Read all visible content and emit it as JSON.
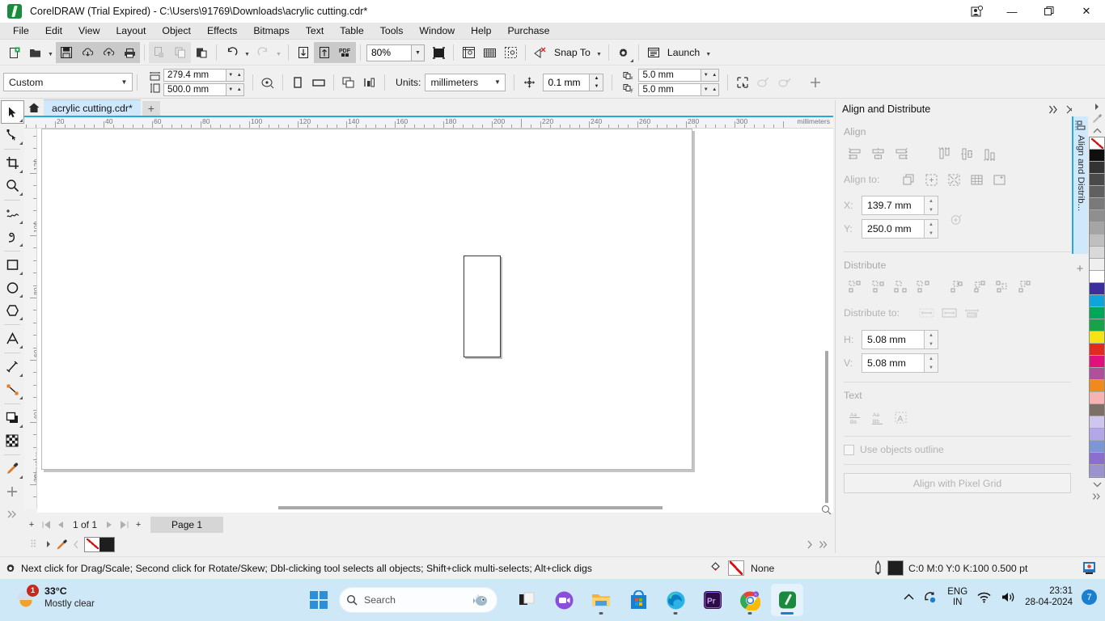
{
  "window": {
    "title": "CorelDRAW (Trial Expired) - C:\\Users\\91769\\Downloads\\acrylic cutting.cdr*",
    "minimize_label": "—",
    "maximize_label": "❐",
    "close_label": "✕",
    "account_icon": "account-icon"
  },
  "menu": {
    "items": [
      {
        "label": "File"
      },
      {
        "label": "Edit"
      },
      {
        "label": "View"
      },
      {
        "label": "Layout"
      },
      {
        "label": "Object"
      },
      {
        "label": "Effects"
      },
      {
        "label": "Bitmaps"
      },
      {
        "label": "Text"
      },
      {
        "label": "Table"
      },
      {
        "label": "Tools"
      },
      {
        "label": "Window"
      },
      {
        "label": "Help"
      },
      {
        "label": "Purchase"
      }
    ]
  },
  "standard_toolbar": {
    "buttons": [
      {
        "name": "new-document",
        "icon": "new-doc-icon"
      },
      {
        "name": "open-document",
        "icon": "open-folder-icon"
      },
      {
        "name": "save-document",
        "icon": "save-icon"
      },
      {
        "name": "download-from-cloud",
        "icon": "cloud-download-icon"
      },
      {
        "name": "upload-to-cloud",
        "icon": "cloud-upload-icon"
      },
      {
        "name": "print",
        "icon": "printer-icon"
      },
      {
        "name": "cut",
        "icon": "cut-icon"
      },
      {
        "name": "copy",
        "icon": "copy-icon"
      },
      {
        "name": "paste",
        "icon": "paste-icon"
      },
      {
        "name": "undo",
        "icon": "undo-icon"
      },
      {
        "name": "redo",
        "icon": "redo-icon"
      },
      {
        "name": "import",
        "icon": "import-icon"
      },
      {
        "name": "export",
        "icon": "export-icon"
      },
      {
        "name": "export-pdf",
        "icon": "pdf-icon"
      }
    ],
    "zoom_level": "80%",
    "fullscreen_preview": "fullscreen-preview-icon",
    "view_rulers": "rulers-icon",
    "view_grid": "grid-icon",
    "view_guides": "guides-icon",
    "snap_off": "snap-off-icon",
    "snap_to_label": "Snap To",
    "options_label": "options-gear-icon",
    "launch_label": "Launch"
  },
  "property_bar": {
    "page_preset": "Custom",
    "page_width": "279.4 mm",
    "page_height": "500.0 mm",
    "orientation_portrait": "portrait-icon",
    "orientation_landscape": "landscape-icon",
    "all_pages_icon": "all-pages-icon",
    "current_page_icon": "current-page-icon",
    "auto_fit_icon": "auto-fit-page-icon",
    "units_label": "Units:",
    "units_value": "millimeters",
    "nudge_icon": "nudge-icon",
    "nudge_value": "0.1 mm",
    "duplicate_x_label": "X",
    "duplicate_x": "5.0 mm",
    "duplicate_y_label": "Y",
    "duplicate_y": "5.0 mm",
    "bounding_box_icon": "bounding-box-icon",
    "edit_shape_icon": "edit-shape-icon",
    "accept_shape_icon": "accept-shape-icon",
    "add_icon": "plus-icon"
  },
  "document_tabs": {
    "home_icon": "home-icon",
    "active_tab": "acrylic cutting.cdr*",
    "add_tab": "+"
  },
  "toolbox": {
    "tools": [
      {
        "name": "pick-tool",
        "icon": "arrow-cursor-icon",
        "active": true
      },
      {
        "name": "shape-tool",
        "icon": "node-edit-icon",
        "active": false
      },
      {
        "name": "crop-tool",
        "icon": "crop-icon",
        "active": false
      },
      {
        "name": "zoom-tool",
        "icon": "magnifier-icon",
        "active": false
      },
      {
        "name": "freehand-tool",
        "icon": "freehand-pen-icon",
        "active": false
      },
      {
        "name": "artistic-media-tool",
        "icon": "artistic-media-icon",
        "active": false
      },
      {
        "name": "rectangle-tool",
        "icon": "rectangle-icon",
        "active": false
      },
      {
        "name": "ellipse-tool",
        "icon": "ellipse-icon",
        "active": false
      },
      {
        "name": "polygon-tool",
        "icon": "polygon-icon",
        "active": false
      },
      {
        "name": "text-tool",
        "icon": "text-a-icon",
        "active": false
      },
      {
        "name": "parallel-dimension-tool",
        "icon": "dimension-line-icon",
        "active": false
      },
      {
        "name": "connector-tool",
        "icon": "connector-icon",
        "active": false
      },
      {
        "name": "drop-shadow-tool",
        "icon": "drop-shadow-icon",
        "active": false
      },
      {
        "name": "transparency-tool",
        "icon": "transparency-checker-icon",
        "active": false
      },
      {
        "name": "color-eyedropper-tool",
        "icon": "eyedropper-icon",
        "active": false
      },
      {
        "name": "interactive-fill-tool",
        "icon": "plus-fill-icon",
        "active": false
      },
      {
        "name": "more-tools",
        "icon": "chevron-double-right-icon",
        "active": false
      }
    ]
  },
  "rulers": {
    "unit_label": "millimeters",
    "horizontal_ticks": [
      20,
      40,
      60,
      80,
      100,
      120,
      140,
      160,
      180,
      200,
      220,
      240,
      260,
      280,
      300
    ],
    "vertical_ticks": [
      20,
      40,
      60,
      80,
      100,
      120
    ]
  },
  "canvas": {
    "shape_name": "rectangle-object"
  },
  "page_nav": {
    "add_page_before": "+",
    "first_page": "⏮",
    "prev_page": "◀",
    "page_counter": "1 of 1",
    "next_page": "▶",
    "last_page": "⏭",
    "add_page_after": "+",
    "page_tab": "Page 1"
  },
  "color_status_strip": {
    "expand_icon": "expand-arrow-icon",
    "eyedropper_icon": "eyedropper-icon",
    "back_icon": "nav-back-icon",
    "fill_swatch": "none",
    "outline_swatch": "#1e1e1e"
  },
  "docker": {
    "title": "Align and Distribute",
    "collapse_icon": "collapse-right-icon",
    "close_icon": "close-icon",
    "align_section": "Align",
    "align_buttons": [
      {
        "name": "align-left",
        "icon": "align-left-icon"
      },
      {
        "name": "align-center-horizontally",
        "icon": "align-center-h-icon"
      },
      {
        "name": "align-right",
        "icon": "align-right-icon"
      },
      {
        "name": "align-top",
        "icon": "align-top-icon"
      },
      {
        "name": "align-center-vertically",
        "icon": "align-center-v-icon"
      },
      {
        "name": "align-bottom",
        "icon": "align-bottom-icon"
      }
    ],
    "align_to_label": "Align to:",
    "align_to_buttons": [
      {
        "name": "align-to-active-objects",
        "icon": "active-objects-icon"
      },
      {
        "name": "align-to-page-edge",
        "icon": "page-edge-icon"
      },
      {
        "name": "align-to-page-center",
        "icon": "page-center-icon"
      },
      {
        "name": "align-to-grid",
        "icon": "grid-icon"
      },
      {
        "name": "align-to-specified-point",
        "icon": "specified-point-icon"
      }
    ],
    "x_label": "X:",
    "x_value": "139.7 mm",
    "y_label": "Y:",
    "y_value": "250.0 mm",
    "pick_point_icon": "pick-point-icon",
    "distribute_section": "Distribute",
    "distribute_buttons": [
      {
        "name": "distribute-left",
        "icon": "distribute-left-icon"
      },
      {
        "name": "distribute-center-horizontally",
        "icon": "distribute-center-h-icon"
      },
      {
        "name": "distribute-space-horizontally",
        "icon": "distribute-space-h-icon"
      },
      {
        "name": "distribute-right",
        "icon": "distribute-right-icon"
      },
      {
        "name": "distribute-top",
        "icon": "distribute-top-icon"
      },
      {
        "name": "distribute-center-vertically",
        "icon": "distribute-center-v-icon"
      },
      {
        "name": "distribute-space-vertically",
        "icon": "distribute-space-v-icon"
      },
      {
        "name": "distribute-bottom",
        "icon": "distribute-bottom-icon"
      }
    ],
    "distribute_to_label": "Distribute to:",
    "distribute_to_buttons": [
      {
        "name": "distribute-to-selection-extent",
        "icon": "selection-extent-icon"
      },
      {
        "name": "distribute-to-page-extent",
        "icon": "page-extent-icon"
      },
      {
        "name": "distribute-to-spacing",
        "icon": "spacing-icon"
      }
    ],
    "h_label": "H:",
    "h_value": "5.08 mm",
    "v_label": "V:",
    "v_value": "5.08 mm",
    "text_section": "Text",
    "text_buttons": [
      {
        "name": "text-first-line-baseline",
        "icon": "first-line-baseline-icon"
      },
      {
        "name": "text-last-line-baseline",
        "icon": "last-line-baseline-icon"
      },
      {
        "name": "text-bounding-box",
        "icon": "text-bounding-box-icon"
      }
    ],
    "use_objects_outline": "Use objects outline",
    "align_pixel_grid": "Align with Pixel Grid",
    "tab_label": "Align and Distrib...",
    "tab_icon": "align-distribute-icon",
    "add_docker": "+"
  },
  "palette": {
    "scroll_up": "▲",
    "scroll_down": "▼",
    "expand": "»",
    "eyedropper_icon": "eyedropper-icon",
    "nav_icon": "palette-nav-icon",
    "colors": [
      "none",
      "#0f0f0f",
      "#333333",
      "#4a4a4a",
      "#606060",
      "#7a7a7a",
      "#8f8f8f",
      "#a5a5a5",
      "#bfbfbf",
      "#d9d9d9",
      "#efefef",
      "#ffffff",
      "#3b2f9c",
      "#0ea5dc",
      "#00a65a",
      "#16a34a",
      "#f5e316",
      "#e02b20",
      "#e0117c",
      "#b0509b",
      "#f08a1c",
      "#f7b3b3",
      "#7d6f66",
      "#cfc6ef",
      "#b3a7e8",
      "#7d96d6",
      "#8b6fd0",
      "#9a93cf"
    ]
  },
  "status_bar": {
    "gear_icon": "options-gear-icon",
    "hint": "Next click for Drag/Scale; Second click for Rotate/Skew; Dbl-clicking tool selects all objects; Shift+click multi-selects; Alt+click digs",
    "fill_icon": "fill-color-icon",
    "fill_value": "None",
    "outline_icon": "outline-pen-icon",
    "outline_value": "C:0 M:0 Y:0 K:100  0.500 pt",
    "snapshot_icon": "snapshot-icon"
  },
  "taskbar": {
    "weather_temp": "33°C",
    "weather_desc": "Mostly clear",
    "weather_badge": "1",
    "start_icon": "windows-start-icon",
    "search_placeholder": "Search",
    "search_mascot": "fish-mascot-icon",
    "apps": [
      {
        "name": "task-view",
        "icon": "task-view-icon"
      },
      {
        "name": "zoom-app",
        "icon": "zoom-camera-icon"
      },
      {
        "name": "file-explorer",
        "icon": "folder-icon"
      },
      {
        "name": "microsoft-store",
        "icon": "store-bag-icon"
      },
      {
        "name": "microsoft-edge",
        "icon": "edge-icon"
      },
      {
        "name": "adobe-premiere-pro",
        "icon": "premiere-pro-icon"
      },
      {
        "name": "google-chrome",
        "icon": "chrome-icon"
      },
      {
        "name": "coreldraw",
        "icon": "coreldraw-icon"
      }
    ],
    "tray_chevron": "⌃",
    "tray_onedrive": "onedrive-sync-icon",
    "lang_line1": "ENG",
    "lang_line2": "IN",
    "wifi_icon": "wifi-icon",
    "volume_icon": "speaker-icon",
    "clock_time": "23:31",
    "clock_date": "28-04-2024",
    "notification_count": "7"
  }
}
